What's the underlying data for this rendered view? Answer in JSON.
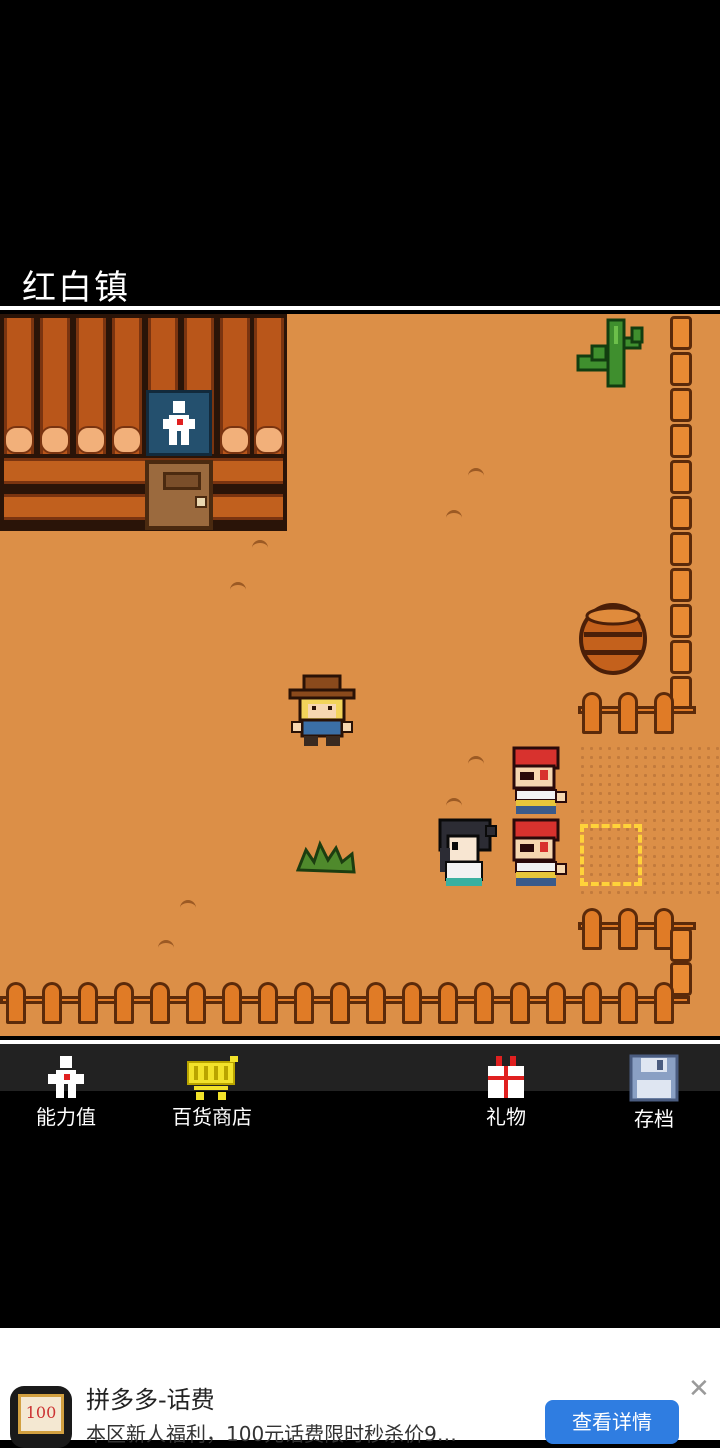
{
  "location": {
    "title": "红白镇"
  },
  "menu": {
    "items": [
      {
        "id": "stats",
        "label": "能力值",
        "icon": "character-icon"
      },
      {
        "id": "shop",
        "label": "百货商店",
        "icon": "shopping-cart-icon"
      },
      {
        "id": "gift",
        "label": "礼物",
        "icon": "gift-icon"
      },
      {
        "id": "save",
        "label": "存档",
        "icon": "floppy-disk-icon"
      }
    ]
  },
  "ad": {
    "icon_text": "100",
    "title": "拼多多-话费",
    "description": "本区新人福利，100元话费限时秒杀价9…",
    "button_label": "查看详情",
    "close_symbol": "✕"
  },
  "colors": {
    "ground": "#dc8f47",
    "fence": "#e07b26",
    "cursor": "#ffd23a",
    "ad_button": "#2f7de1"
  }
}
